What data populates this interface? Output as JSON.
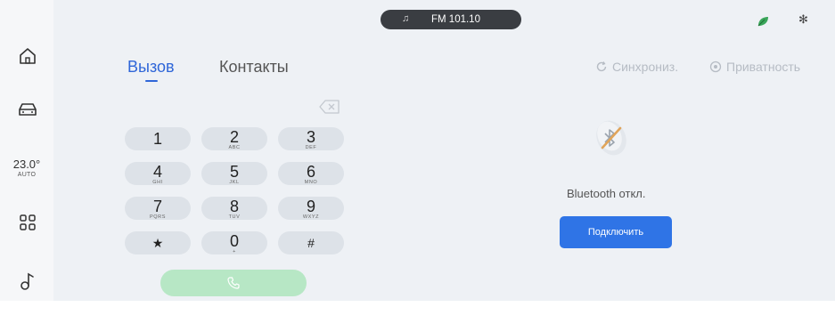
{
  "media": {
    "icon": "music-note-icon",
    "station": "FM 101.10"
  },
  "status": {
    "eco_icon": "leaf-icon",
    "bt_icon": "bluetooth-icon",
    "bt_glyph": "✻"
  },
  "nav": {
    "items": [
      {
        "icon": "home-icon"
      },
      {
        "icon": "car-icon"
      },
      {
        "icon": "apps-grid-icon"
      },
      {
        "icon": "music-icon"
      }
    ],
    "climate": {
      "temp": "23.0",
      "unit": "°",
      "mode": "AUTO"
    }
  },
  "tabs": {
    "call": "Вызов",
    "contacts": "Контакты"
  },
  "actions": {
    "sync": "Синхрониз.",
    "privacy": "Приватность"
  },
  "keypad": {
    "keys": [
      {
        "digit": "1",
        "letters": ""
      },
      {
        "digit": "2",
        "letters": "ABC"
      },
      {
        "digit": "3",
        "letters": "DEF"
      },
      {
        "digit": "4",
        "letters": "GHI"
      },
      {
        "digit": "5",
        "letters": "JKL"
      },
      {
        "digit": "6",
        "letters": "MNO"
      },
      {
        "digit": "7",
        "letters": "PQRS"
      },
      {
        "digit": "8",
        "letters": "TUV"
      },
      {
        "digit": "9",
        "letters": "WXYZ"
      },
      {
        "digit": "★",
        "letters": ""
      },
      {
        "digit": "0",
        "letters": "+"
      },
      {
        "digit": "#",
        "letters": ""
      }
    ]
  },
  "bluetooth": {
    "status": "Bluetooth откл.",
    "connect_label": "Подключить"
  },
  "colors": {
    "accent": "#2f66d8",
    "button_blue": "#2f74e6",
    "call_green": "#b7e7c5",
    "key_bg": "#dde2e8"
  }
}
